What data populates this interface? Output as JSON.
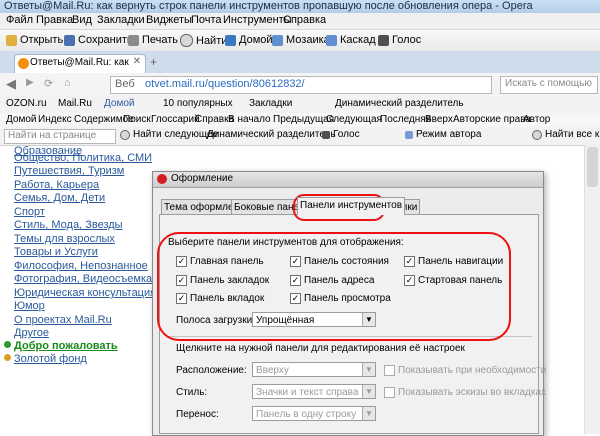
{
  "window": {
    "title": "Ответы@Mail.Ru: как вернуть строк панели инструментов пропавшую после обновления опера - Opera"
  },
  "menu": [
    "Файл",
    "Правка",
    "Вид",
    "Закладки",
    "Виджеты",
    "Почта",
    "Инструменты",
    "Справка"
  ],
  "toolbar": {
    "open": "Открыть",
    "save": "Сохранить",
    "print": "Печать",
    "find": "Найти",
    "home": "Домой",
    "mosaic": "Мозаика",
    "cascade": "Каскад",
    "voice": "Голос"
  },
  "tab": {
    "label": "Ответы@Mail.Ru: как в..."
  },
  "address": {
    "prefix": "Веб",
    "url": "otvet.mail.ru/question/80612832/",
    "search_placeholder": "Искать с помощью"
  },
  "bookmarks": {
    "ozon": "OZON.ru",
    "mail": "Mail.Ru",
    "home": "Домой",
    "popular": "10 популярных",
    "bookmarks": "Закладки",
    "divider": "Динамический разделитель"
  },
  "navbar": [
    "Домой",
    "Индекс",
    "Содержимое",
    "Поиск",
    "Глоссарий",
    "Справка",
    "В начало",
    "Предыдущая",
    "Следующая",
    "Последняя",
    "Вверх",
    "Авторские права",
    "Автор"
  ],
  "findbar": {
    "placeholder": "Найти на странице",
    "find_next": "Найти следующее",
    "divider": "Динамический разделитель",
    "voice": "Голос",
    "author_mode": "Режим автора",
    "find_all": "Найти все к"
  },
  "sidebar": [
    "Образование",
    "Общество, Политика, СМИ",
    "Путешествия, Туризм",
    "Работа, Карьера",
    "Семья, Дом, Дети",
    "Спорт",
    "Стиль, Мода, Звезды",
    "Темы для взрослых",
    "Товары и Услуги",
    "Философия, Непознанное",
    "Фотография, Видеосъемка",
    "Юридическая консультация",
    "Юмор",
    "О проектах Mail.Ru",
    "Другое",
    "Добро пожаловать",
    "Золотой фонд"
  ],
  "dialog": {
    "title": "Оформление",
    "tabs": [
      "Тема оформления",
      "Боковые панели",
      "Панели инструментов",
      "Кнопки"
    ],
    "section_label": "Выберите панели инструментов для отображения:",
    "checkboxes": [
      {
        "label": "Главная панель",
        "checked": true
      },
      {
        "label": "Панель состояния",
        "checked": true
      },
      {
        "label": "Панель навигации",
        "checked": true
      },
      {
        "label": "Панель закладок",
        "checked": true
      },
      {
        "label": "Панель адреса",
        "checked": true
      },
      {
        "label": "Стартовая панель",
        "checked": true
      },
      {
        "label": "Панель вкладок",
        "checked": true
      },
      {
        "label": "Панель просмотра",
        "checked": true
      }
    ],
    "progress_label": "Полоса загрузки:",
    "progress_value": "Упрощённая",
    "hint": "Щелкните на нужной панели для редактирования её настроек",
    "position_label": "Расположение:",
    "position_value": "Вверху",
    "style_label": "Стиль:",
    "style_value": "Значки и текст справа",
    "wrap_label": "Перенос:",
    "wrap_value": "Панель в одну строку",
    "opt_show_needed": "Показывать при необходимости",
    "opt_show_thumbs": "Показывать эскизы во вкладках"
  },
  "colors": {
    "annotation": "#e11111",
    "link": "#2a5a9a",
    "link_green": "#1a8a1a"
  }
}
